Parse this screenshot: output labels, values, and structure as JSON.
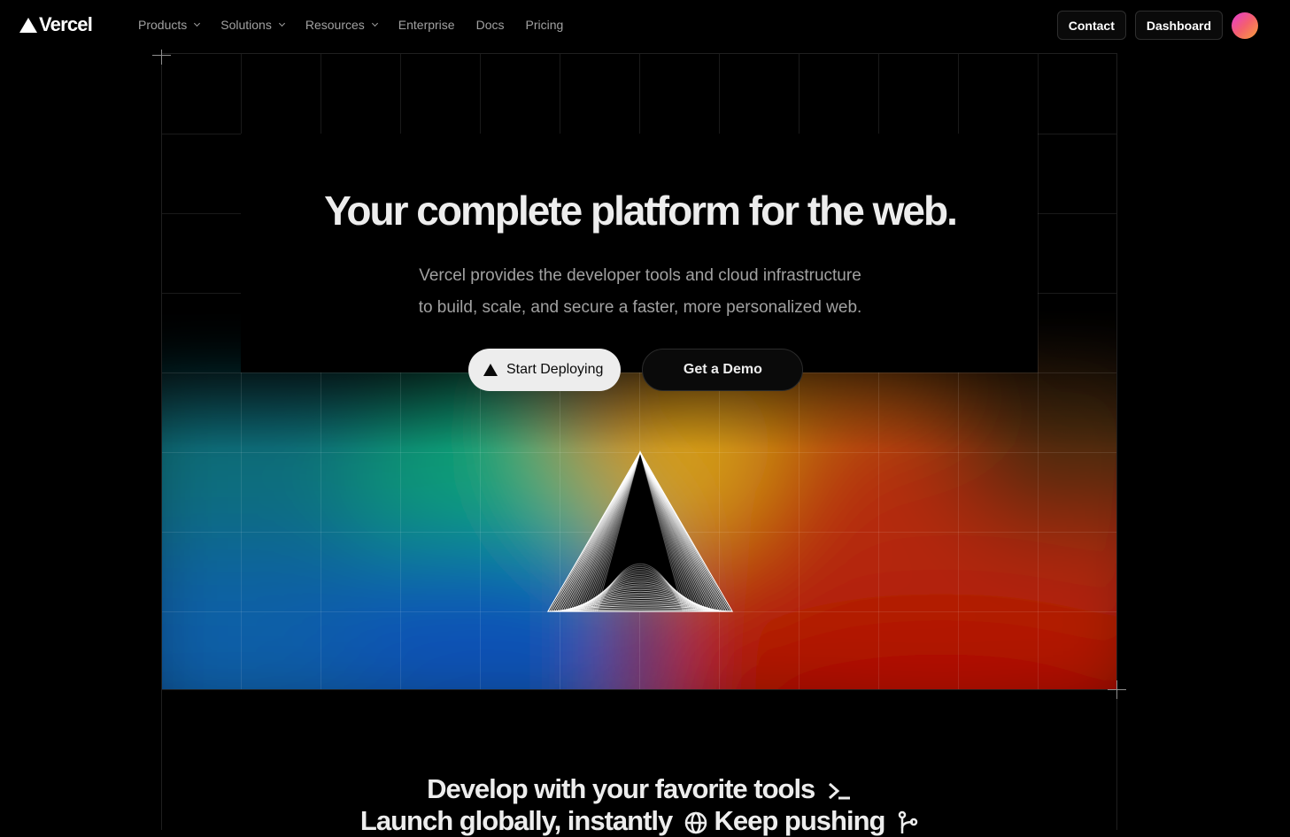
{
  "nav": {
    "logo_text": "Vercel",
    "items": [
      {
        "label": "Products",
        "has_dropdown": true
      },
      {
        "label": "Solutions",
        "has_dropdown": true
      },
      {
        "label": "Resources",
        "has_dropdown": true
      },
      {
        "label": "Enterprise",
        "has_dropdown": false
      },
      {
        "label": "Docs",
        "has_dropdown": false
      },
      {
        "label": "Pricing",
        "has_dropdown": false
      }
    ],
    "contact_label": "Contact",
    "dashboard_label": "Dashboard"
  },
  "hero": {
    "title": "Your complete platform for the web.",
    "subtitle_line1": "Vercel provides the developer tools and cloud infrastructure",
    "subtitle_line2": "to build, scale, and secure a faster, more personalized web.",
    "primary_cta": "Start Deploying",
    "secondary_cta": "Get a Demo"
  },
  "tagline": {
    "part1": "Develop with your favorite tools",
    "part2": "Launch globally, instantly",
    "part3": "Keep pushing",
    "icons": [
      "terminal-icon",
      "globe-icon",
      "branch-icon"
    ]
  },
  "colors": {
    "background": "#000000",
    "text": "#ededed",
    "muted": "#a1a1a1",
    "border": "#2e2e2e"
  }
}
